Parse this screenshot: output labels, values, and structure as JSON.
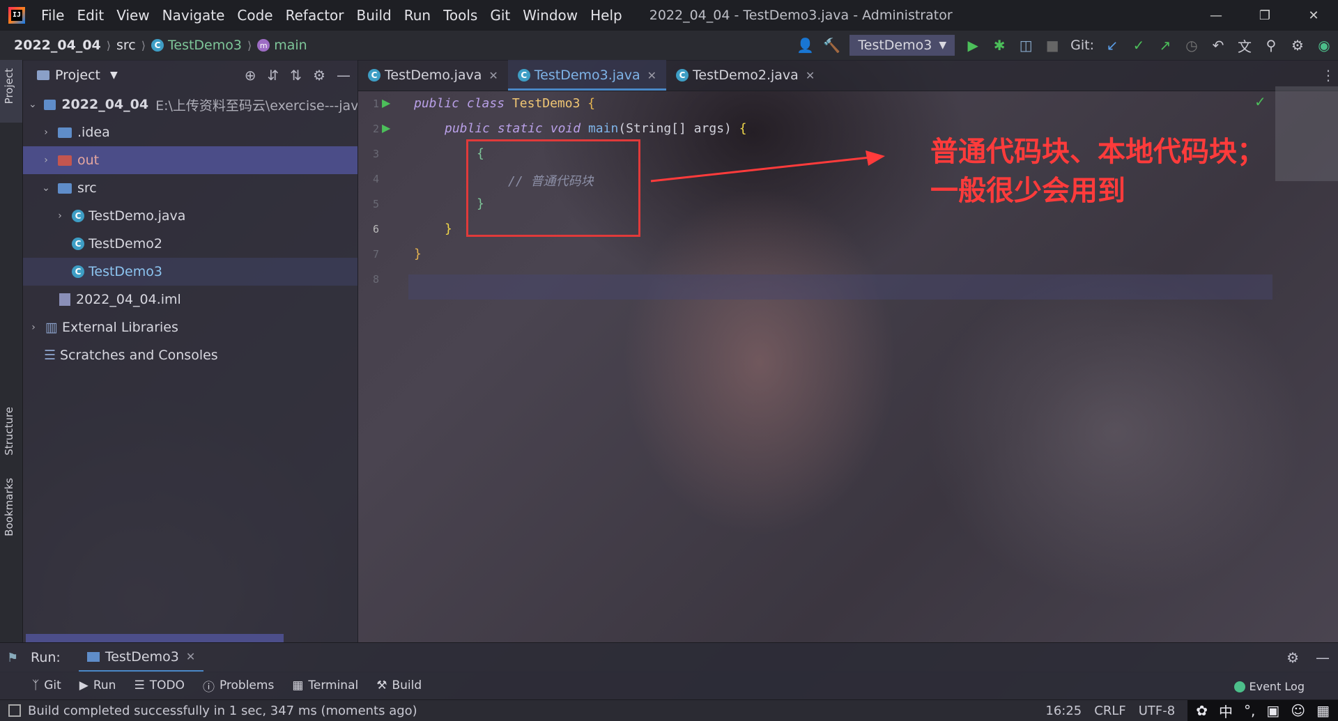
{
  "window": {
    "title": "2022_04_04 - TestDemo3.java - Administrator"
  },
  "menu": [
    "File",
    "Edit",
    "View",
    "Navigate",
    "Code",
    "Refactor",
    "Build",
    "Run",
    "Tools",
    "Git",
    "Window",
    "Help"
  ],
  "breadcrumbs": {
    "project": "2022_04_04",
    "folder": "src",
    "class": "TestDemo3",
    "method": "main"
  },
  "toolbar": {
    "run_config": "TestDemo3",
    "git_label": "Git:"
  },
  "project_panel": {
    "title": "Project",
    "root": {
      "name": "2022_04_04",
      "path": "E:\\上传资料至码云\\exercise---java-cc"
    },
    "items": [
      {
        "label": ".idea"
      },
      {
        "label": "out"
      },
      {
        "label": "src"
      },
      {
        "label": "TestDemo.java"
      },
      {
        "label": "TestDemo2"
      },
      {
        "label": "TestDemo3"
      },
      {
        "label": "2022_04_04.iml"
      },
      {
        "label": "External Libraries"
      },
      {
        "label": "Scratches and Consoles"
      }
    ]
  },
  "side_tabs": {
    "project": "Project",
    "structure": "Structure",
    "bookmarks": "Bookmarks"
  },
  "editor": {
    "tabs": [
      {
        "label": "TestDemo.java"
      },
      {
        "label": "TestDemo3.java"
      },
      {
        "label": "TestDemo2.java"
      }
    ],
    "line_numbers": [
      "1",
      "2",
      "3",
      "4",
      "5",
      "6",
      "7",
      "8"
    ],
    "code": {
      "l1_kw1": "public",
      "l1_kw2": "class",
      "l1_name": "TestDemo3",
      "l1_brace": "{",
      "l2_kw1": "public",
      "l2_kw2": "static",
      "l2_kw3": "void",
      "l2_fn": "main",
      "l2_params": "(String[] args)",
      "l2_brace": "{",
      "l3": "{",
      "l4_comment": "// 普通代码块",
      "l5": "}",
      "l6": "}",
      "l7": "}"
    },
    "annotation": [
      "普通代码块、本地代码块；",
      "一般很少会用到"
    ]
  },
  "run_panel": {
    "label": "Run:",
    "tab": "TestDemo3"
  },
  "tool_windows": [
    {
      "label": "Git"
    },
    {
      "label": "Run"
    },
    {
      "label": "TODO"
    },
    {
      "label": "Problems"
    },
    {
      "label": "Terminal"
    },
    {
      "label": "Build"
    }
  ],
  "event_log": "Event Log",
  "status": {
    "message": "Build completed successfully in 1 sec, 347 ms (moments ago)",
    "position": "16:25",
    "line_sep": "CRLF",
    "encoding": "UTF-8"
  },
  "tray": {
    "ime": "中"
  },
  "colors": {
    "accent": "#4a88c7",
    "annotation": "#ff3b3b",
    "selection": "#50529a",
    "run_green": "#4cbf5a"
  }
}
